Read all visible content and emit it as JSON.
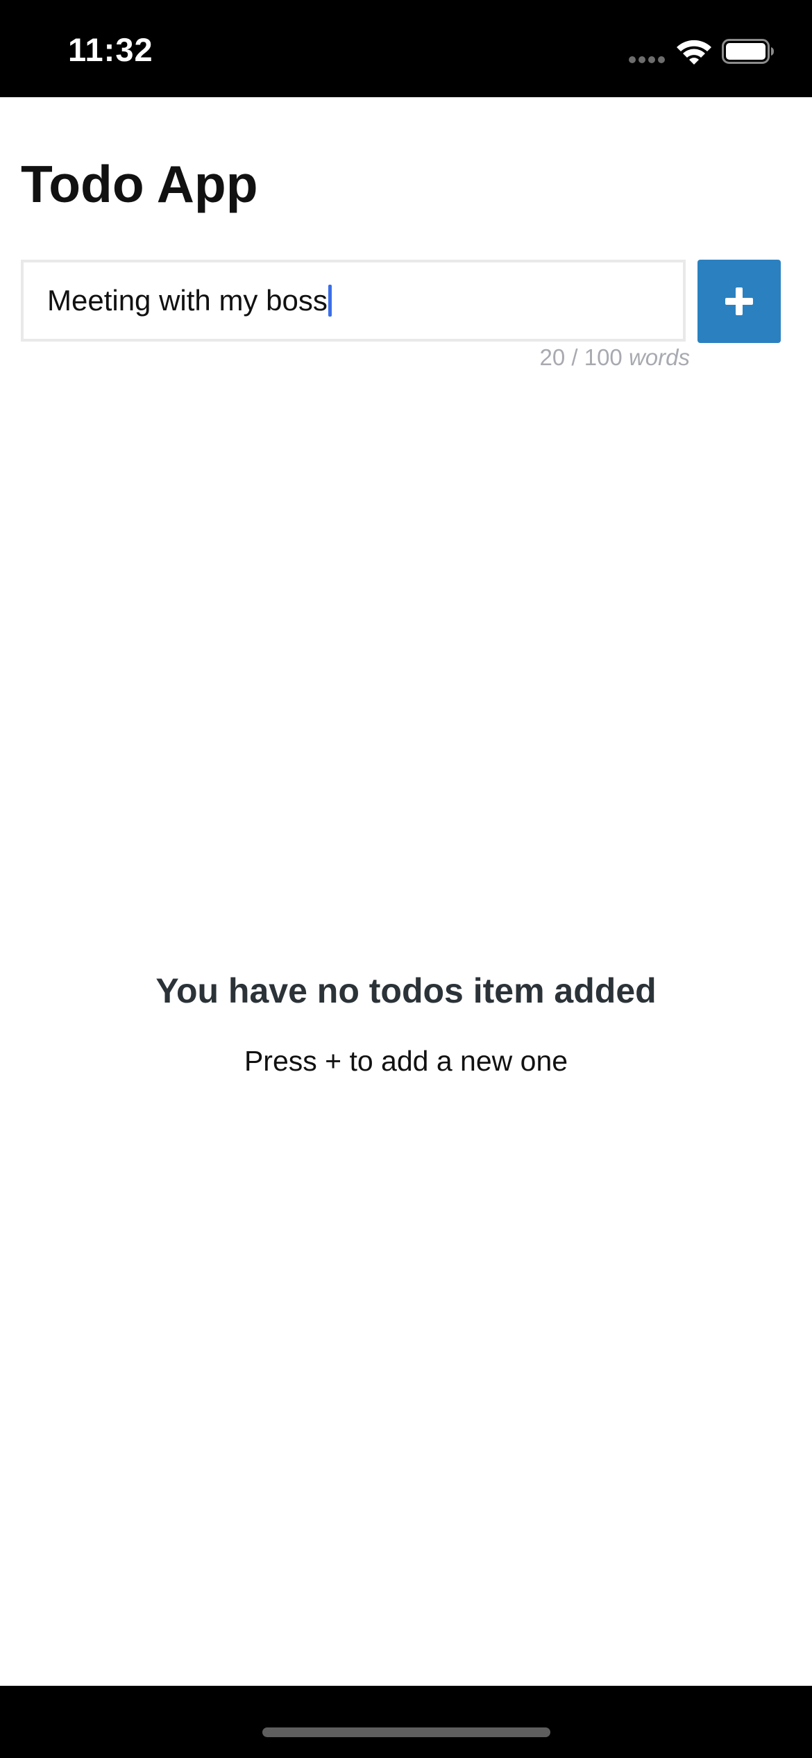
{
  "status_bar": {
    "time": "11:32",
    "icons": [
      "cellular-signal-icon",
      "wifi-icon",
      "battery-icon"
    ]
  },
  "header": {
    "title": "Todo App"
  },
  "todo_form": {
    "input_value": "Meeting with my boss",
    "add_button_icon": "plus-icon",
    "counter_value": "20 / 100",
    "counter_unit": "words"
  },
  "empty_state": {
    "title": "You have no todos item added",
    "subtitle": "Press + to add a new one"
  },
  "colors": {
    "accent": "#2b81c0",
    "caret": "#3b6ee8",
    "counter_text": "#a8aab0",
    "empty_title": "#2b3338"
  }
}
